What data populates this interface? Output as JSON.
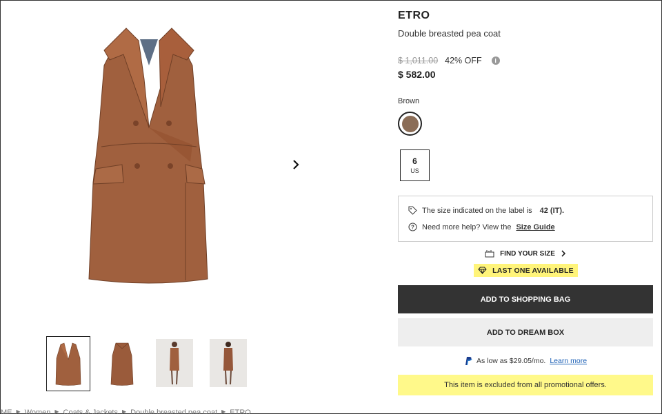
{
  "product": {
    "brand": "ETRO",
    "name": "Double breasted pea coat",
    "original_price": "$ 1,011.00",
    "discount": "42% OFF",
    "price": "$ 582.00",
    "color_label": "Brown",
    "color_hex": "#8b6d57",
    "size_value": "6",
    "size_unit": "US"
  },
  "size_info": {
    "label_text": "The size indicated on the label is",
    "label_size": "42 (IT).",
    "help_text": "Need more help? View the",
    "guide_link": "Size Guide"
  },
  "actions": {
    "find_size": "FIND YOUR SIZE",
    "last_one": "LAST ONE AVAILABLE",
    "add_bag": "ADD TO SHOPPING BAG",
    "add_dream": "ADD TO DREAM BOX"
  },
  "paypal": {
    "text": "As low as $29.05/mo.",
    "link": "Learn more"
  },
  "promo_notice": "This item is excluded from all promotional offers.",
  "breadcrumb": [
    "ME",
    "Women",
    "Coats & Jackets",
    "Double breasted pea coat",
    "ETRO"
  ],
  "icons": {
    "info": "info-icon",
    "next": "chevron-right-icon",
    "tag": "tag-icon",
    "help": "question-circle-icon",
    "ruler": "ruler-icon",
    "diamond": "diamond-icon",
    "paypal": "paypal-icon"
  },
  "colors": {
    "coat": "#a0603e",
    "primary_button": "#333333",
    "highlight": "#fff47a",
    "link": "#1b5fb5"
  }
}
